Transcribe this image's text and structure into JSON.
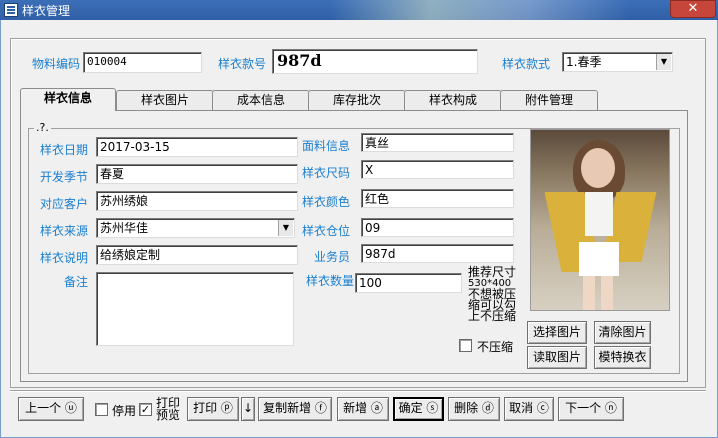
{
  "window": {
    "title": "样衣管理",
    "close_label": "✕"
  },
  "header": {
    "material_code_label": "物料编码",
    "material_code_value": "010004",
    "style_no_label": "样衣款号",
    "style_no_value": "987d",
    "style_type_label": "样衣款式",
    "style_type_value": "1.春季"
  },
  "tabs": [
    {
      "label": "样衣信息",
      "active": true
    },
    {
      "label": "样衣图片",
      "active": false
    },
    {
      "label": "成本信息",
      "active": false
    },
    {
      "label": "库存批次",
      "active": false
    },
    {
      "label": "样衣构成",
      "active": false
    },
    {
      "label": "附件管理",
      "active": false
    }
  ],
  "group_title": ".?.",
  "form": {
    "date_label": "样衣日期",
    "date_value": "2017-03-15",
    "season_label": "开发季节",
    "season_value": "春夏",
    "customer_label": "对应客户",
    "customer_value": "苏州绣娘",
    "source_label": "样衣来源",
    "source_value": "苏州华佳",
    "desc_label": "样衣说明",
    "desc_value": "给绣娘定制",
    "remark_label": "备注",
    "remark_value": "",
    "fabric_label": "面料信息",
    "fabric_value": "真丝",
    "size_label": "样衣尺码",
    "size_value": "X",
    "color_label": "样衣颜色",
    "color_value": "红色",
    "location_label": "样衣仓位",
    "location_value": "09",
    "salesman_label": "业务员",
    "salesman_value": "987d",
    "qty_label": "样衣数量",
    "qty_value": "100"
  },
  "image_hint": {
    "line1": "推荐尺寸",
    "line2": "530*400",
    "line3": "不想被压",
    "line4": "缩可以勾",
    "line5": "上不压缩"
  },
  "no_compress_label": "不压缩",
  "image_buttons": {
    "select": "选择图片",
    "clear": "清除图片",
    "read": "读取图片",
    "model": "模特换衣"
  },
  "toolbar": {
    "prev": "上一个 ⓤ",
    "disable_label": "停用",
    "print_preview_line1": "打印",
    "print_preview_line2": "预览",
    "print": "打印 ⓟ",
    "arrow": "↓",
    "copy_new": "复制新增 ⓕ",
    "add": "新增 ⓐ",
    "confirm": "确定 ⓢ",
    "delete": "删除 ⓓ",
    "cancel": "取消 ⓒ",
    "next": "下一个 ⓝ"
  },
  "colors": {
    "label_blue": "#1a7fd0",
    "titlebar": "#2f5fa6",
    "close_red": "#c7463b"
  }
}
